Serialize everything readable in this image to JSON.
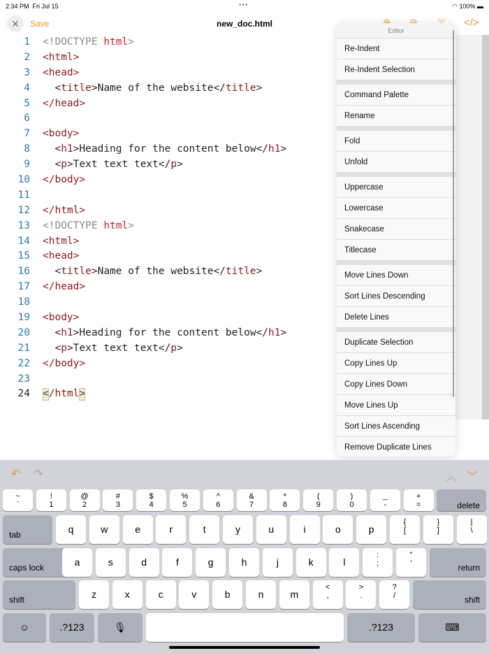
{
  "status": {
    "time": "2:34 PM",
    "date": "Fri Jul 15",
    "battery": "100%"
  },
  "toolbar": {
    "save": "Save",
    "title": "new_doc.html",
    "code_icon": "</>"
  },
  "code": [
    "<!DOCTYPE html>",
    "<html>",
    "<head>",
    "  <title>Name of the website</title>",
    "</head>",
    "",
    "<body>",
    "  <h1>Heading for the content below</h1>",
    "  <p>Text text text</p>",
    "</body>",
    "",
    "</html>",
    "<!DOCTYPE html>",
    "<html>",
    "<head>",
    "  <title>Name of the website</title>",
    "</head>",
    "",
    "<body>",
    "  <h1>Heading for the content below</h1>",
    "  <p>Text text text</p>",
    "</body>",
    "",
    "</html>"
  ],
  "menu": {
    "header": "Editor",
    "groups": [
      [
        "Re-Indent",
        "Re-Indent Selection"
      ],
      [
        "Command Palette",
        "Rename"
      ],
      [
        "Fold",
        "Unfold"
      ],
      [
        "Uppercase",
        "Lowercase",
        "Snakecase",
        "Titlecase"
      ],
      [
        "Move Lines Down",
        "Sort Lines Descending",
        "Delete Lines"
      ],
      [
        "Duplicate Selection",
        "Copy Lines Up",
        "Copy Lines Down",
        "Move Lines Up",
        "Sort Lines Ascending",
        "Remove Duplicate Lines"
      ]
    ]
  },
  "keyboard": {
    "row1": [
      [
        "~",
        "`"
      ],
      [
        "!",
        "1"
      ],
      [
        "@",
        "2"
      ],
      [
        "#",
        "3"
      ],
      [
        "$",
        "4"
      ],
      [
        "%",
        "5"
      ],
      [
        "^",
        "6"
      ],
      [
        "&",
        "7"
      ],
      [
        "*",
        "8"
      ],
      [
        "(",
        "9"
      ],
      [
        ")",
        "0"
      ],
      [
        "_",
        "-"
      ],
      [
        "+",
        "="
      ]
    ],
    "delete": "delete",
    "tab": "tab",
    "row2": [
      "q",
      "w",
      "e",
      "r",
      "t",
      "y",
      "u",
      "i",
      "o",
      "p",
      [
        "{",
        "["
      ],
      [
        "}",
        "]"
      ],
      [
        "|",
        "\\"
      ]
    ],
    "caps": "caps lock",
    "return": "return",
    "row3": [
      "a",
      "s",
      "d",
      "f",
      "g",
      "h",
      "j",
      "k",
      "l",
      [
        ":",
        ";"
      ],
      [
        "\"",
        "'"
      ]
    ],
    "shift": "shift",
    "row4": [
      "z",
      "x",
      "c",
      "v",
      "b",
      "n",
      "m",
      [
        "<",
        ","
      ],
      [
        ">",
        "."
      ],
      [
        "?",
        "/"
      ]
    ],
    "num": ".?123"
  },
  "colors": {
    "accent": "#f0932b"
  }
}
